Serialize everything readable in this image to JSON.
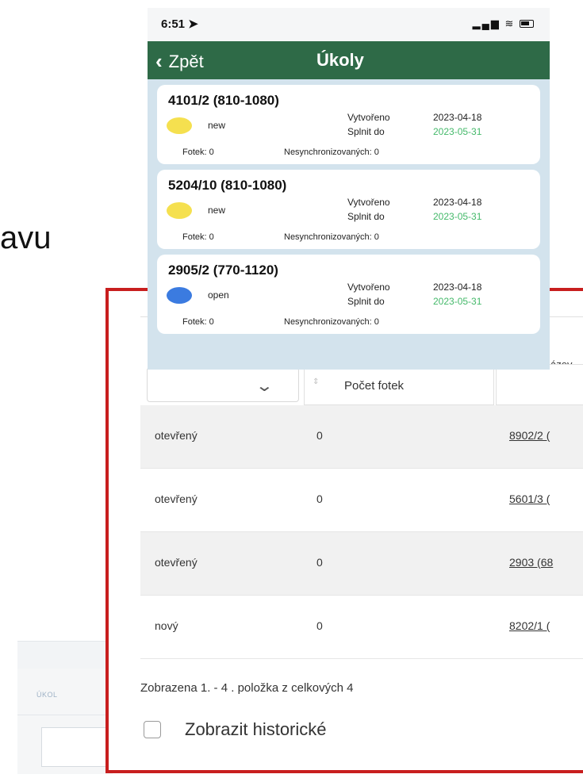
{
  "background_fragment": "avu",
  "faded_snippet": {
    "label": "ÚKOL"
  },
  "phone": {
    "status_time": "6:51",
    "status_icons": "▂▄▆ ≋",
    "back_label": "Zpět",
    "title": "Úkoly",
    "tasks": [
      {
        "title": "4101/2 (810-1080)",
        "status": "new",
        "status_color": "#f5e04f",
        "created_label": "Vytvořeno",
        "created": "2023-04-18",
        "due_label": "Splnit do",
        "due": "2023-05-31",
        "photos": "Fotek: 0",
        "unsynced": "Nesynchronizovaných: 0"
      },
      {
        "title": "5204/10 (810-1080)",
        "status": "new",
        "status_color": "#f5e04f",
        "created_label": "Vytvořeno",
        "created": "2023-04-18",
        "due_label": "Splnit do",
        "due": "2023-05-31",
        "photos": "Fotek: 0",
        "unsynced": "Nesynchronizovaných: 0"
      },
      {
        "title": "2905/2 (770-1120)",
        "status": "open",
        "status_color": "#3b7be0",
        "created_label": "Vytvořeno",
        "created": "2023-04-18",
        "due_label": "Splnit do",
        "due": "2023-05-31",
        "photos": "Fotek: 0",
        "unsynced": "Nesynchronizovaných: 0"
      }
    ]
  },
  "web": {
    "header_fragment": "ázev",
    "column_photo_count": "Počet fotek",
    "rows": [
      {
        "state": "otevřený",
        "photos": "0",
        "task": "8902/2 ("
      },
      {
        "state": "otevřený",
        "photos": "0",
        "task": "5601/3 ("
      },
      {
        "state": "otevřený",
        "photos": "0",
        "task": "2903 (68"
      },
      {
        "state": "nový",
        "photos": "0",
        "task": "8202/1 ("
      }
    ],
    "footer": "Zobrazena 1. - 4 . položka z celkových 4",
    "show_historic_label": "Zobrazit historické",
    "frame_color": "#c81e1e"
  }
}
